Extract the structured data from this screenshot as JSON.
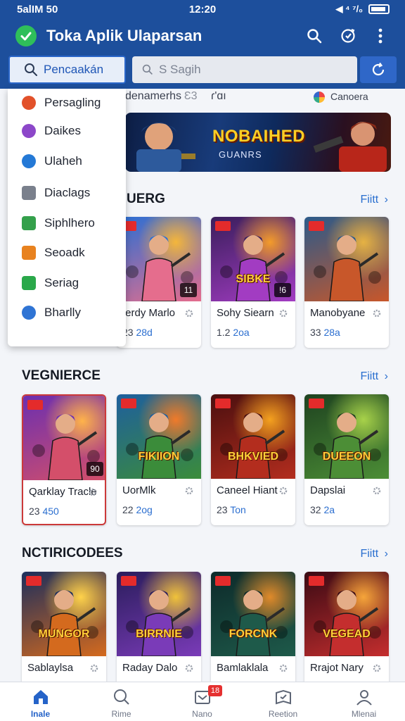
{
  "status": {
    "left": "5alIM 50",
    "time": "12:20",
    "signal": "◀ ⁴ ⁷/₀"
  },
  "app": {
    "title": "Toka Aplik Ulaparsan"
  },
  "tab": {
    "label": "Pencaakán"
  },
  "search": {
    "placeholder": "S  Sagih"
  },
  "crumbs": [
    "denamerhs",
    "Ɛ3",
    "ɾ'ɑı",
    "Canoera"
  ],
  "banner": {
    "title": "NOBAIHED",
    "subtitle": "GUANRS"
  },
  "dropdown": {
    "items": [
      {
        "label": "Persagling",
        "color": "#e2512a"
      },
      {
        "label": "Daikes",
        "color": "#8c47c9"
      },
      {
        "label": "Ulaheh",
        "color": "#2479d6"
      },
      {
        "label": "Diaclags",
        "color": "#7a808c"
      },
      {
        "label": "Siphlhero",
        "color": "#34a04b"
      },
      {
        "label": "Seoadk",
        "color": "#e8821f"
      },
      {
        "label": "Seriag",
        "color": "#2aa84a"
      },
      {
        "label": "Bharlly",
        "color": "#2f74d4"
      }
    ]
  },
  "sections": [
    {
      "title": "UERG",
      "link": "Fiitt",
      "cards": [
        {
          "title": "Ierdy Marlo",
          "meta1": "23",
          "meta2": "28d",
          "rating": "11",
          "word": "",
          "colors": [
            "#2b6fd3",
            "#e56d8d",
            "#f4b63b"
          ]
        },
        {
          "title": "Sohy Siearn",
          "meta1": "1.2",
          "meta2": "2oa",
          "rating": "!6",
          "word": "SIBKE",
          "colors": [
            "#3a1e5c",
            "#a23cc2",
            "#f39b2a"
          ]
        },
        {
          "title": "Manobyane",
          "meta1": "33",
          "meta2": "28a",
          "rating": "",
          "word": "",
          "colors": [
            "#2b5a8a",
            "#c8572a",
            "#e6b243"
          ]
        }
      ]
    },
    {
      "title": "VEGNIERCE",
      "link": "Fiitt",
      "cards": [
        {
          "title": "Qarklay Tracle",
          "meta1": "23",
          "meta2": "450",
          "rating": "90",
          "word": "",
          "colors": [
            "#6b2fb0",
            "#d44f6a",
            "#ffb34a"
          ]
        },
        {
          "title": "UorMlk",
          "meta1": "22",
          "meta2": "2og",
          "rating": "",
          "word": "FIKIION",
          "colors": [
            "#1e5f9e",
            "#3b8c3a",
            "#f07a2a"
          ]
        },
        {
          "title": "Caneel Hiant",
          "meta1": "23",
          "meta2": "Ton",
          "rating": "",
          "word": "BHKVIED",
          "colors": [
            "#4a0f0f",
            "#b32d1e",
            "#f4a11f"
          ]
        },
        {
          "title": "Dapslai",
          "meta1": "32",
          "meta2": "2a",
          "rating": "",
          "word": "DUEEON",
          "colors": [
            "#1e4220",
            "#4c8e36",
            "#a8d24a"
          ]
        }
      ]
    },
    {
      "title": "NCTIRICODEES",
      "link": "Fiitt",
      "cards": [
        {
          "title": "Sablaylsa",
          "meta1": "",
          "meta2": "",
          "rating": "",
          "word": "MUNGOR",
          "colors": [
            "#1c2e5c",
            "#d46a1e",
            "#ffd24a"
          ]
        },
        {
          "title": "Raday Dalo",
          "meta1": "",
          "meta2": "",
          "rating": "",
          "word": "BIRRNIE",
          "colors": [
            "#2a1d5c",
            "#7a3bb8",
            "#f0c23a"
          ]
        },
        {
          "title": "Bamlaklala",
          "meta1": "",
          "meta2": "",
          "rating": "",
          "word": "FORCNK",
          "colors": [
            "#0d2a2a",
            "#1e5a4a",
            "#e08a2a"
          ]
        },
        {
          "title": "Rrajot Nary",
          "meta1": "",
          "meta2": "",
          "rating": "",
          "word": "VEGEAD",
          "colors": [
            "#3a0a14",
            "#c42e2e",
            "#f6a53a"
          ]
        }
      ]
    }
  ],
  "nav": [
    {
      "label": "Inale",
      "icon": "home-icon",
      "active": true
    },
    {
      "label": "Rime",
      "icon": "search-icon"
    },
    {
      "label": "Nano",
      "icon": "inbox-icon",
      "badge": "18"
    },
    {
      "label": "Reetion",
      "icon": "reviews-icon"
    },
    {
      "label": "Mlenai",
      "icon": "profile-icon"
    }
  ]
}
